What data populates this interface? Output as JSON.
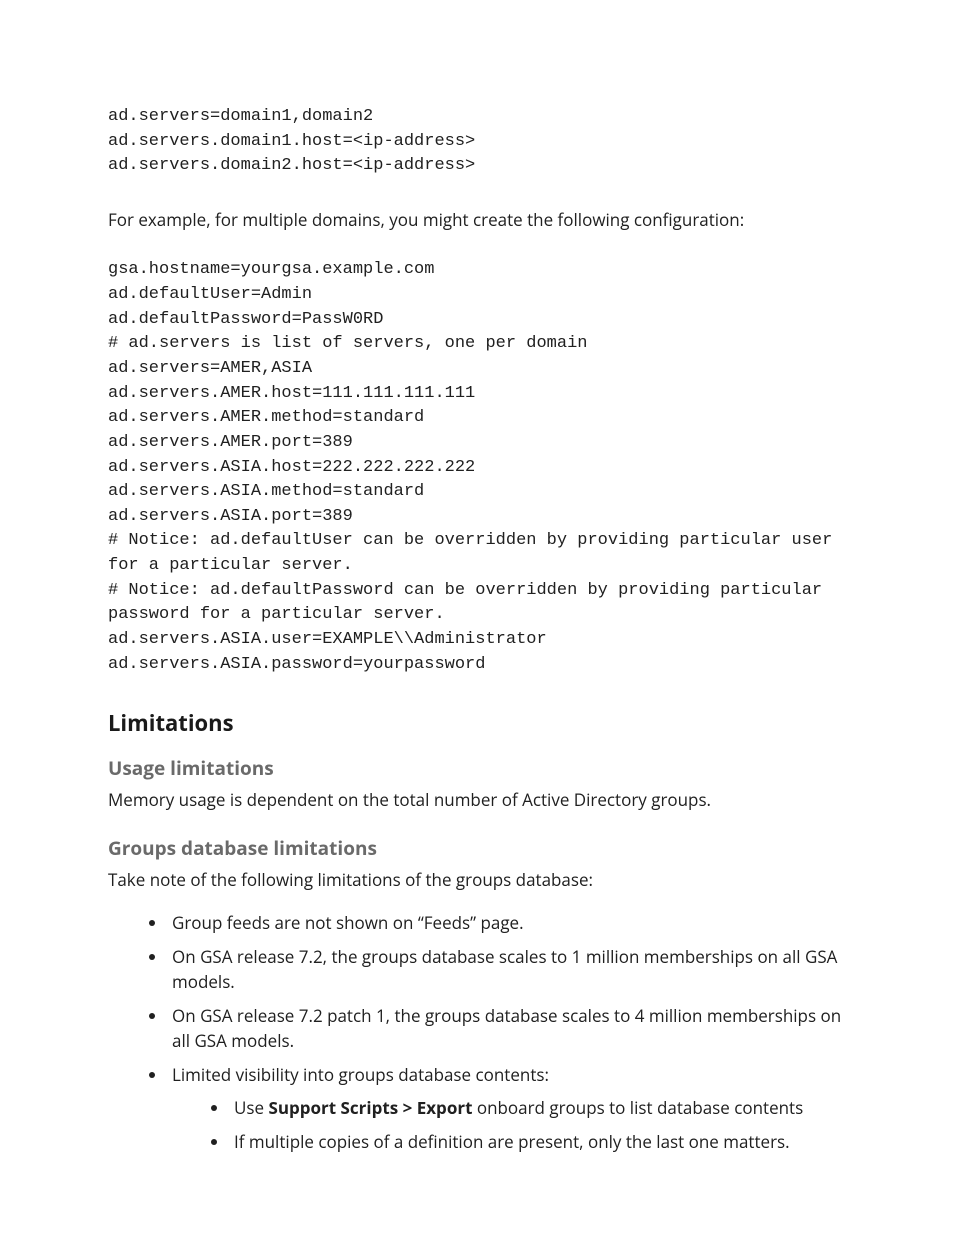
{
  "code1": "ad.servers=domain1,domain2\nad.servers.domain1.host=<ip-address>\nad.servers.domain2.host=<ip-address>",
  "para1": "For example, for multiple domains, you might create the following configuration:",
  "code2": "gsa.hostname=yourgsa.example.com\nad.defaultUser=Admin\nad.defaultPassword=PassW0RD\n# ad.servers is list of servers, one per domain\nad.servers=AMER,ASIA\nad.servers.AMER.host=111.111.111.111\nad.servers.AMER.method=standard\nad.servers.AMER.port=389\nad.servers.ASIA.host=222.222.222.222\nad.servers.ASIA.method=standard\nad.servers.ASIA.port=389\n# Notice: ad.defaultUser can be overridden by providing particular user for a particular server.\n# Notice: ad.defaultPassword can be overridden by providing particular password for a particular server.\nad.servers.ASIA.user=EXAMPLE\\\\Administrator\nad.servers.ASIA.password=yourpassword",
  "limitations": {
    "heading": "Limitations",
    "usage": {
      "heading": "Usage limitations",
      "body": "Memory usage is dependent on the total number of Active Directory groups."
    },
    "groups": {
      "heading": "Groups database limitations",
      "intro": "Take note of the following limitations of the groups database:",
      "items": [
        "Group feeds are not shown on “Feeds” page.",
        "On GSA release 7.2, the groups database scales to 1 million memberships on all GSA models.",
        "On GSA release 7.2 patch 1, the groups database scales to 4 million memberships on all GSA models.",
        "Limited visibility into groups database contents:"
      ],
      "sub": {
        "prefix1": "Use ",
        "bold1": "Support Scripts > Export",
        "suffix1": " onboard groups to list database contents",
        "item2": "If multiple copies of a definition are present, only the last one matters."
      }
    }
  }
}
